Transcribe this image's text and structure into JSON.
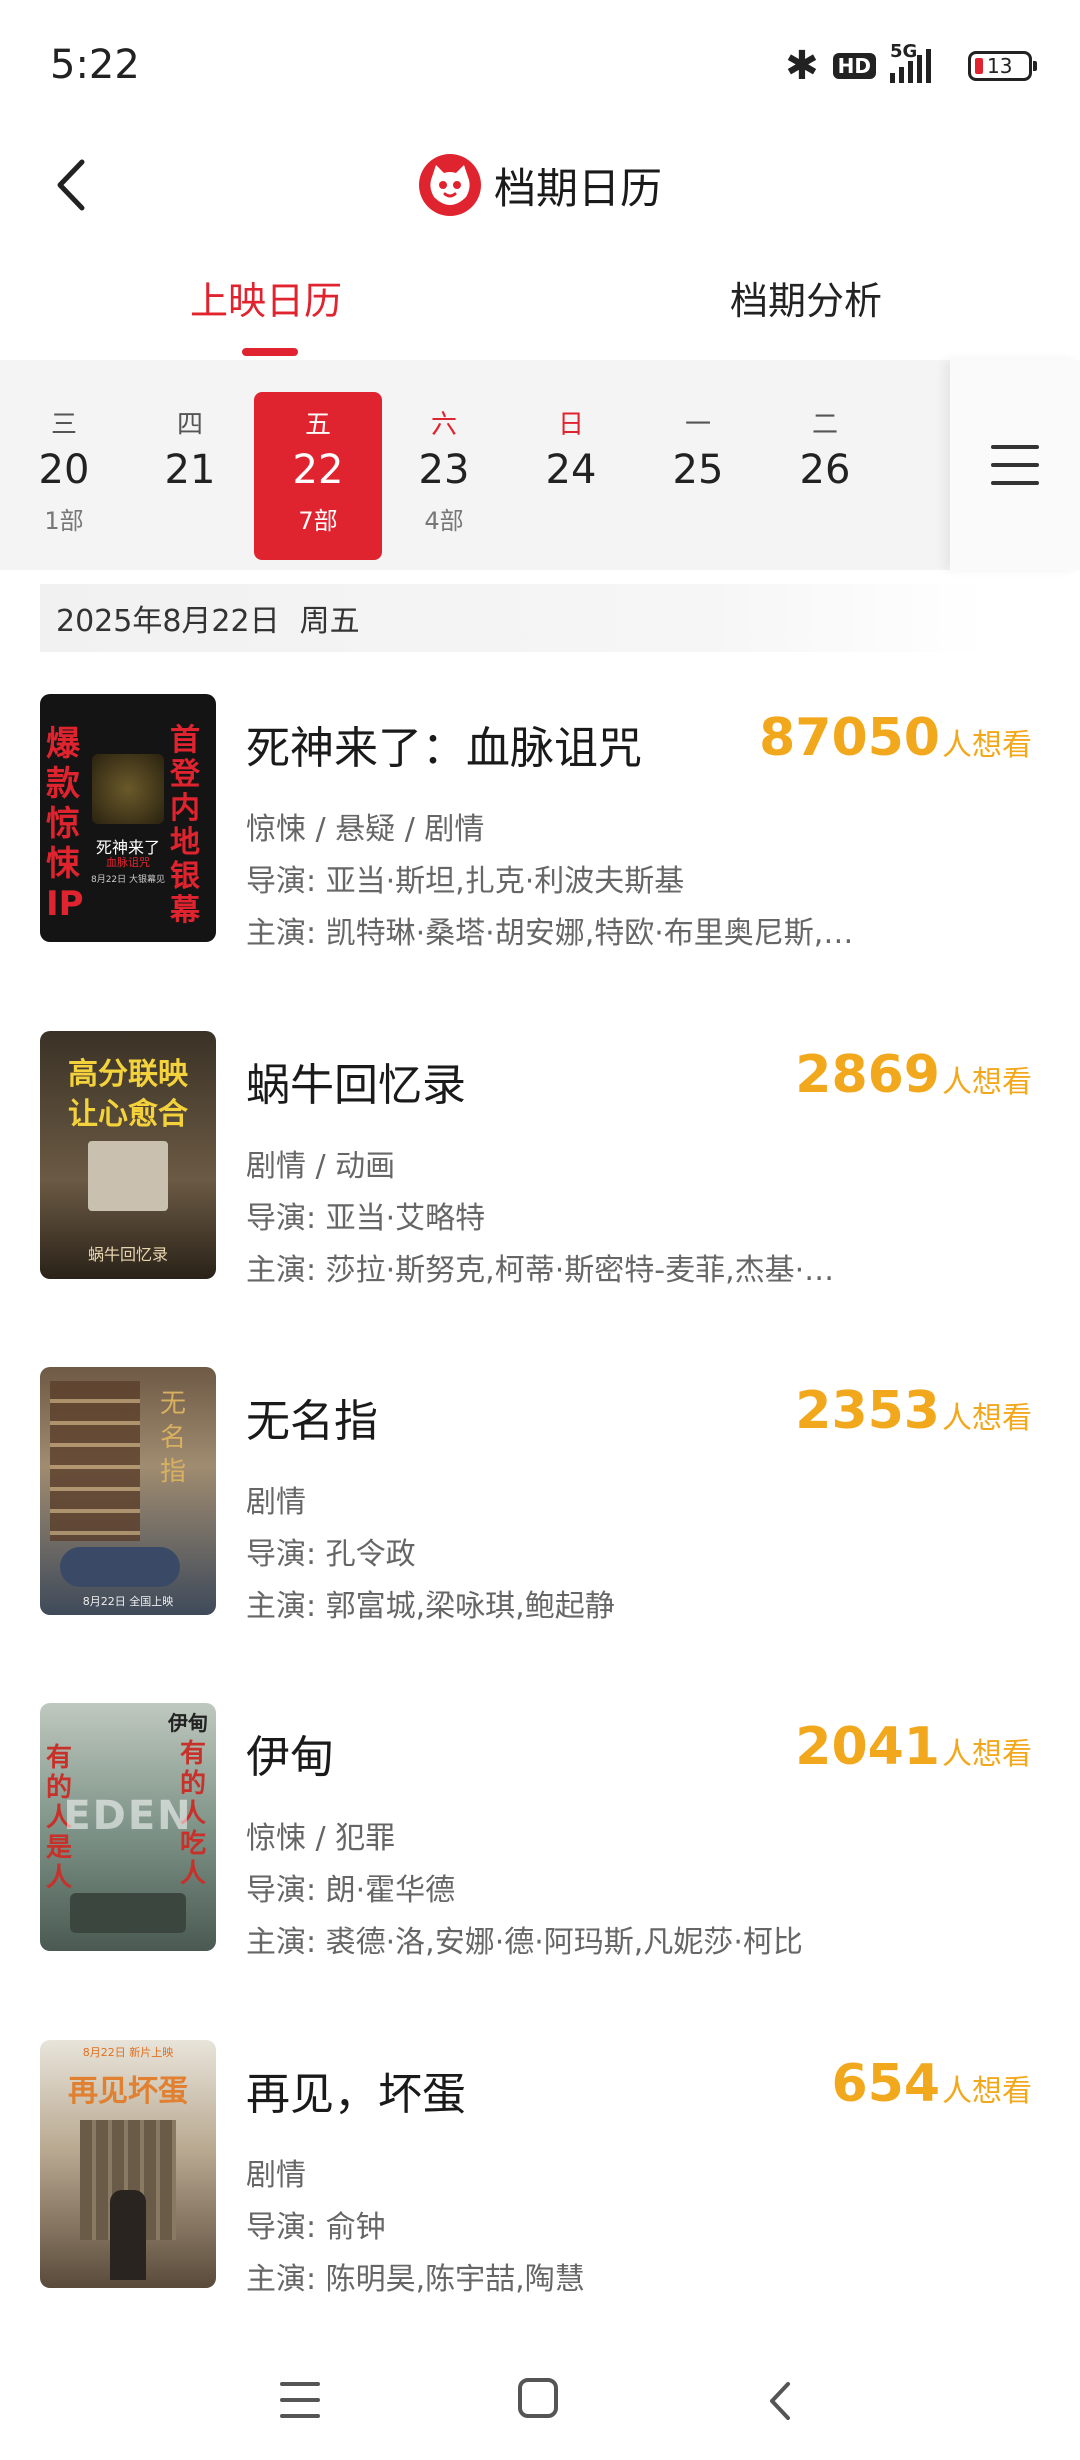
{
  "status_bar": {
    "time": "5:22",
    "bluetooth_icon": "bluetooth-icon",
    "hd_badge": "HD",
    "network": "5G",
    "battery": "13"
  },
  "header": {
    "title": "档期日历"
  },
  "tabs": [
    {
      "label": "上映日历",
      "active": true
    },
    {
      "label": "档期分析",
      "active": false
    }
  ],
  "calendar": {
    "days": [
      {
        "weekday": "三",
        "date": "20",
        "count": "1部",
        "weekend": false,
        "selected": false
      },
      {
        "weekday": "四",
        "date": "21",
        "count": "",
        "weekend": false,
        "selected": false
      },
      {
        "weekday": "五",
        "date": "22",
        "count": "7部",
        "weekend": false,
        "selected": true
      },
      {
        "weekday": "六",
        "date": "23",
        "count": "4部",
        "weekend": true,
        "selected": false
      },
      {
        "weekday": "日",
        "date": "24",
        "count": "",
        "weekend": true,
        "selected": false
      },
      {
        "weekday": "一",
        "date": "25",
        "count": "",
        "weekend": false,
        "selected": false
      },
      {
        "weekday": "二",
        "date": "26",
        "count": "",
        "weekend": false,
        "selected": false
      }
    ]
  },
  "selected_date": {
    "date": "2025年8月22日",
    "weekday": "周五"
  },
  "want_label": "人想看",
  "movies": [
    {
      "title": "死神来了：血脉诅咒",
      "want": "87050",
      "genres": "惊悚 / 悬疑 / 剧情",
      "director": "导演: 亚当·斯坦,扎克·利波夫斯基",
      "cast": "主演: 凯特琳·桑塔·胡安娜,特欧·布里奥尼斯,…"
    },
    {
      "title": "蜗牛回忆录",
      "want": "2869",
      "genres": "剧情 / 动画",
      "director": "导演: 亚当·艾略特",
      "cast": "主演: 莎拉·斯努克,柯蒂·斯密特-麦菲,杰基·…"
    },
    {
      "title": "无名指",
      "want": "2353",
      "genres": "剧情",
      "director": "导演: 孔令政",
      "cast": "主演: 郭富城,梁咏琪,鲍起静"
    },
    {
      "title": "伊甸",
      "want": "2041",
      "genres": "惊悚 / 犯罪",
      "director": "导演: 朗·霍华德",
      "cast": "主演: 裘德·洛,安娜·德·阿玛斯,凡妮莎·柯比"
    },
    {
      "title": "再见，坏蛋",
      "want": "654",
      "genres": "剧情",
      "director": "导演: 俞钟",
      "cast": "主演: 陈明昊,陈宇喆,陶慧"
    }
  ],
  "posters": {
    "m0": {
      "left": "爆款惊悚IP",
      "right": "首登内地银幕",
      "center": "死神来了",
      "sub": "血脉诅咒",
      "date": "8月22日 大银幕见"
    },
    "m1": {
      "line1": "高分联映",
      "line2": "让心愈合",
      "bottom": "蜗牛回忆录"
    },
    "m2": {
      "vertical": "无名指",
      "bottom": "8月22日 全国上映"
    },
    "m3": {
      "top": "伊甸",
      "left": "有的人是人",
      "right": "有的人吃人",
      "center": "EDEN"
    },
    "m4": {
      "top": "8月22日 新片上映",
      "title": "再见坏蛋"
    }
  }
}
